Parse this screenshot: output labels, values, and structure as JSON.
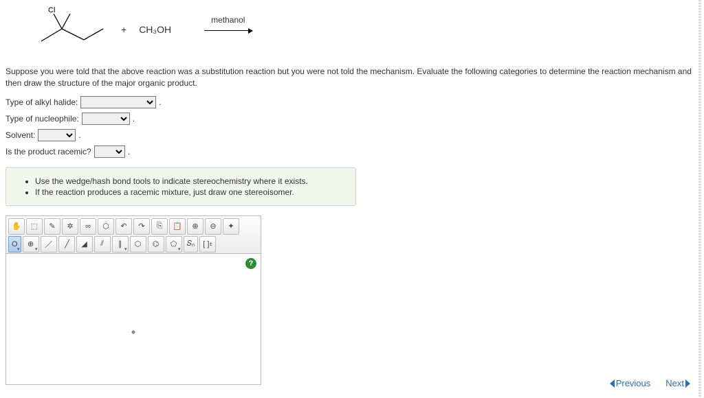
{
  "reaction": {
    "substrate_label_Cl": "Cl",
    "reagent_plus": "+",
    "reagent_formula_html": "CH₃OH",
    "arrow_label": "methanol"
  },
  "prompt": "Suppose you were told that the above reaction was a substitution reaction but you were not told the mechanism. Evaluate the following categories to determine the reaction mechanism and then draw the structure of the major organic product.",
  "fields": {
    "alkyl_halide": {
      "label": "Type of alkyl halide:",
      "value": ""
    },
    "nucleophile": {
      "label": "Type of nucleophile:",
      "value": ""
    },
    "solvent": {
      "label": "Solvent:",
      "value": ""
    },
    "racemic": {
      "label": "Is the product racemic?",
      "value": ""
    }
  },
  "info": {
    "bullet1": "Use the wedge/hash bond tools to indicate stereochemistry where it exists.",
    "bullet2": "If the reaction produces a racemic mixture, just draw one stereoisomer."
  },
  "editor": {
    "help_icon": "?",
    "atom_label": "O",
    "sn_label": "ₙ",
    "bracket_label": "[ ]",
    "charge_label": "±"
  },
  "nav": {
    "prev": "Previous",
    "next": "Next"
  }
}
